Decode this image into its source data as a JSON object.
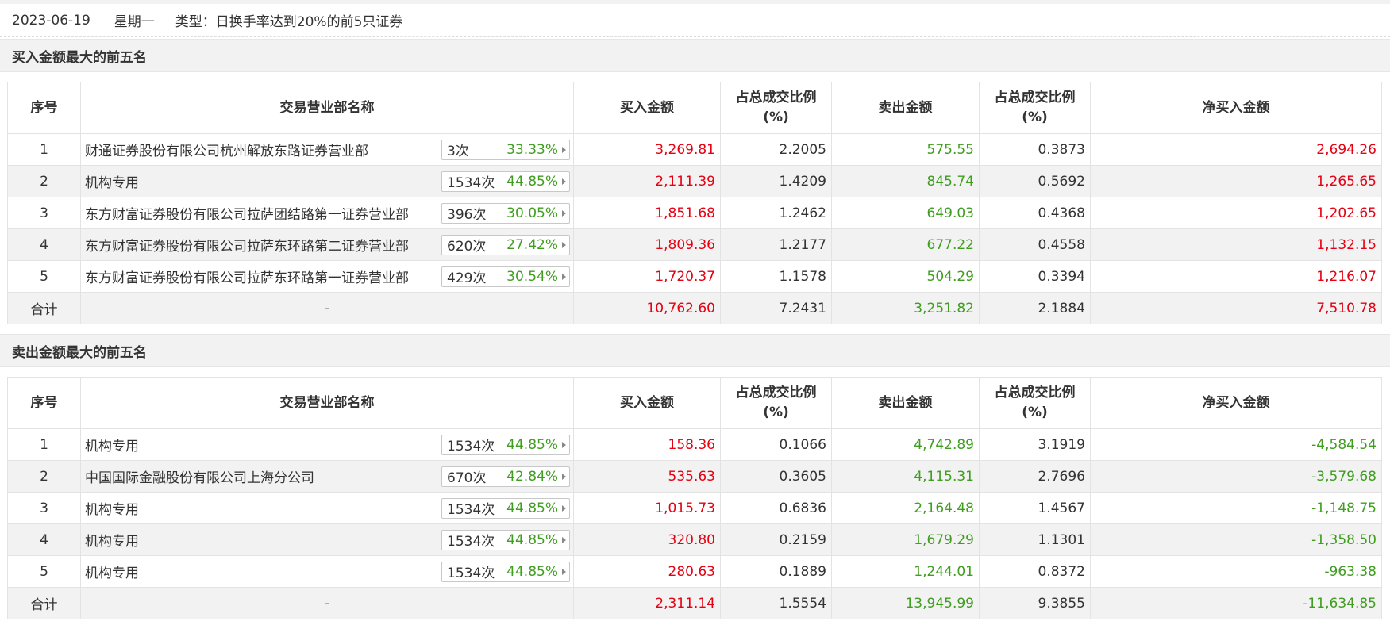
{
  "header": {
    "date": "2023-06-19",
    "weekday": "星期一",
    "type_text": "类型：日换手率达到20%的前5只证券"
  },
  "columns": {
    "idx": "序号",
    "name": "交易营业部名称",
    "buy": "买入金额",
    "buy_ratio_l1": "占总成交比例",
    "buy_ratio_l2": "(%)",
    "sell": "卖出金额",
    "sell_ratio_l1": "占总成交比例",
    "sell_ratio_l2": "(%)",
    "net": "净买入金额"
  },
  "colors": {
    "red": "#e60012",
    "green": "#3f9e1f",
    "section_bg": "#f2f2f2"
  },
  "buy_section": {
    "title": "买入金额最大的前五名",
    "rows": [
      {
        "idx": "1",
        "name": "财通证券股份有限公司杭州解放东路证券营业部",
        "count": "3次",
        "pct": "33.33%",
        "buy": "3,269.81",
        "buy_ratio": "2.2005",
        "sell": "575.55",
        "sell_ratio": "0.3873",
        "net": "2,694.26"
      },
      {
        "idx": "2",
        "name": "机构专用",
        "count": "1534次",
        "pct": "44.85%",
        "buy": "2,111.39",
        "buy_ratio": "1.4209",
        "sell": "845.74",
        "sell_ratio": "0.5692",
        "net": "1,265.65"
      },
      {
        "idx": "3",
        "name": "东方财富证券股份有限公司拉萨团结路第一证券营业部",
        "count": "396次",
        "pct": "30.05%",
        "buy": "1,851.68",
        "buy_ratio": "1.2462",
        "sell": "649.03",
        "sell_ratio": "0.4368",
        "net": "1,202.65"
      },
      {
        "idx": "4",
        "name": "东方财富证券股份有限公司拉萨东环路第二证券营业部",
        "count": "620次",
        "pct": "27.42%",
        "buy": "1,809.36",
        "buy_ratio": "1.2177",
        "sell": "677.22",
        "sell_ratio": "0.4558",
        "net": "1,132.15"
      },
      {
        "idx": "5",
        "name": "东方财富证券股份有限公司拉萨东环路第一证券营业部",
        "count": "429次",
        "pct": "30.54%",
        "buy": "1,720.37",
        "buy_ratio": "1.1578",
        "sell": "504.29",
        "sell_ratio": "0.3394",
        "net": "1,216.07"
      }
    ],
    "total": {
      "label": "合计",
      "name": "-",
      "buy": "10,762.60",
      "buy_ratio": "7.2431",
      "sell": "3,251.82",
      "sell_ratio": "2.1884",
      "net": "7,510.78"
    }
  },
  "sell_section": {
    "title": "卖出金额最大的前五名",
    "rows": [
      {
        "idx": "1",
        "name": "机构专用",
        "count": "1534次",
        "pct": "44.85%",
        "buy": "158.36",
        "buy_ratio": "0.1066",
        "sell": "4,742.89",
        "sell_ratio": "3.1919",
        "net": "-4,584.54"
      },
      {
        "idx": "2",
        "name": "中国国际金融股份有限公司上海分公司",
        "count": "670次",
        "pct": "42.84%",
        "buy": "535.63",
        "buy_ratio": "0.3605",
        "sell": "4,115.31",
        "sell_ratio": "2.7696",
        "net": "-3,579.68"
      },
      {
        "idx": "3",
        "name": "机构专用",
        "count": "1534次",
        "pct": "44.85%",
        "buy": "1,015.73",
        "buy_ratio": "0.6836",
        "sell": "2,164.48",
        "sell_ratio": "1.4567",
        "net": "-1,148.75"
      },
      {
        "idx": "4",
        "name": "机构专用",
        "count": "1534次",
        "pct": "44.85%",
        "buy": "320.80",
        "buy_ratio": "0.2159",
        "sell": "1,679.29",
        "sell_ratio": "1.1301",
        "net": "-1,358.50"
      },
      {
        "idx": "5",
        "name": "机构专用",
        "count": "1534次",
        "pct": "44.85%",
        "buy": "280.63",
        "buy_ratio": "0.1889",
        "sell": "1,244.01",
        "sell_ratio": "0.8372",
        "net": "-963.38"
      }
    ],
    "total": {
      "label": "合计",
      "name": "-",
      "buy": "2,311.14",
      "buy_ratio": "1.5554",
      "sell": "13,945.99",
      "sell_ratio": "9.3855",
      "net": "-11,634.85"
    }
  }
}
